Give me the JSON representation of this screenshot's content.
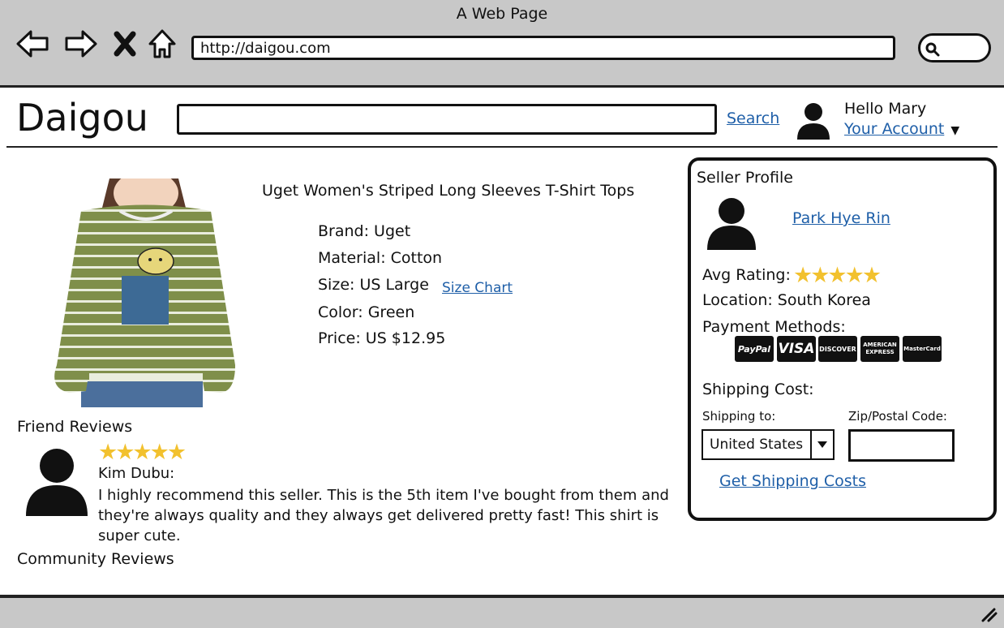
{
  "browser": {
    "title": "A Web Page",
    "url": "http://daigou.com"
  },
  "header": {
    "logo": "Daigou",
    "search_link": "Search",
    "greeting": "Hello Mary",
    "account_link": "Your Account"
  },
  "product": {
    "title": "Uget Women's Striped Long Sleeves T-Shirt Tops",
    "brand": "Brand: Uget",
    "material": "Material: Cotton",
    "size": "Size: US Large",
    "size_chart_link": "Size Chart",
    "color": "Color: Green",
    "price": "Price: US $12.95"
  },
  "reviews": {
    "friend_title": "Friend Reviews",
    "friend_review": {
      "rating": 5,
      "stars": "★★★★★",
      "author": "Kim Dubu:",
      "text": "I highly recommend this seller. This is the 5th item I've bought from them and they're always quality and they always get delivered pretty fast! This shirt is super cute."
    },
    "community_title": "Community Reviews"
  },
  "seller": {
    "title": "Seller Profile",
    "name": "Park Hye Rin",
    "avg_rating_label": "Avg Rating:",
    "rating": 5,
    "stars": "★★★★★",
    "location": "Location: South Korea",
    "payment_label": "Payment Methods:",
    "payment_methods": [
      "PayPal",
      "VISA",
      "DISCOVER",
      "AMERICAN EXPRESS",
      "MasterCard"
    ],
    "shipping_cost_label": "Shipping Cost:",
    "shipping_to_label": "Shipping to:",
    "shipping_to_value": "United States",
    "zip_label": "Zip/Postal Code:",
    "zip_value": "",
    "get_costs_link": "Get Shipping Costs"
  },
  "colors": {
    "chrome": "#c8c8c8",
    "link": "#1f5fa8",
    "star": "#f2c12e",
    "shirt": "#7f8f4a"
  }
}
